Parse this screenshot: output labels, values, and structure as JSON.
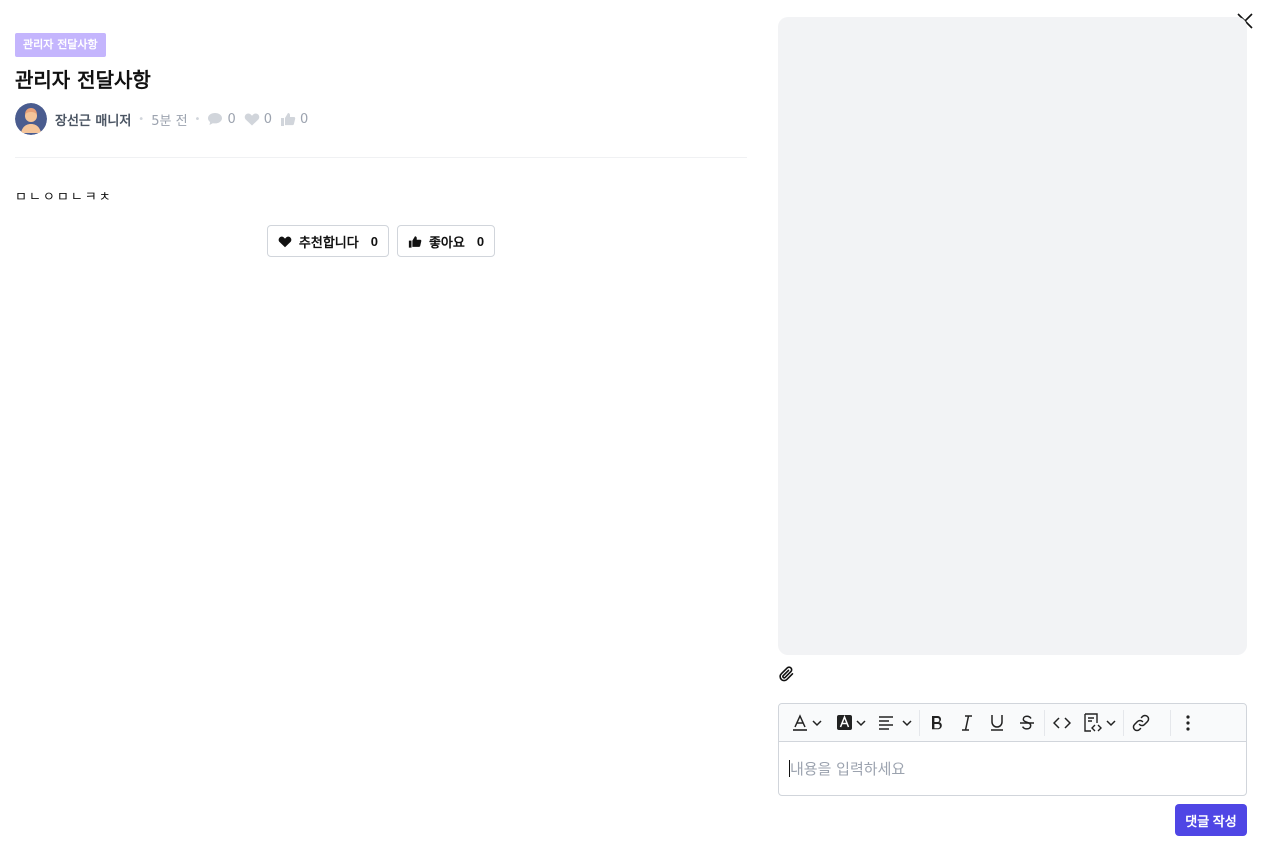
{
  "post": {
    "category_tag": "관리자 전달사항",
    "title": "관리자 전달사항",
    "author": "장선근 매니저",
    "time": "5분 전",
    "comment_count": "0",
    "heart_count": "0",
    "like_count": "0",
    "body": "ㅁㄴㅇㅁㄴㅋㅊ"
  },
  "reactions": {
    "recommend_label": "추천합니다",
    "recommend_count": "0",
    "like_label": "좋아요",
    "like_count": "0"
  },
  "editor": {
    "placeholder": "내용을 입력하세요",
    "toolbar": [
      "font-color-icon",
      "background-color-icon",
      "align-icon",
      "bold-icon",
      "italic-icon",
      "underline-icon",
      "strikethrough-icon",
      "code-icon",
      "code-block-icon",
      "link-icon",
      "more-icon"
    ]
  },
  "submit_label": "댓글 작성",
  "colors": {
    "accent": "#4f46e5",
    "tag_bg": "#c4b5fd",
    "preview_bg": "#f2f3f5"
  }
}
